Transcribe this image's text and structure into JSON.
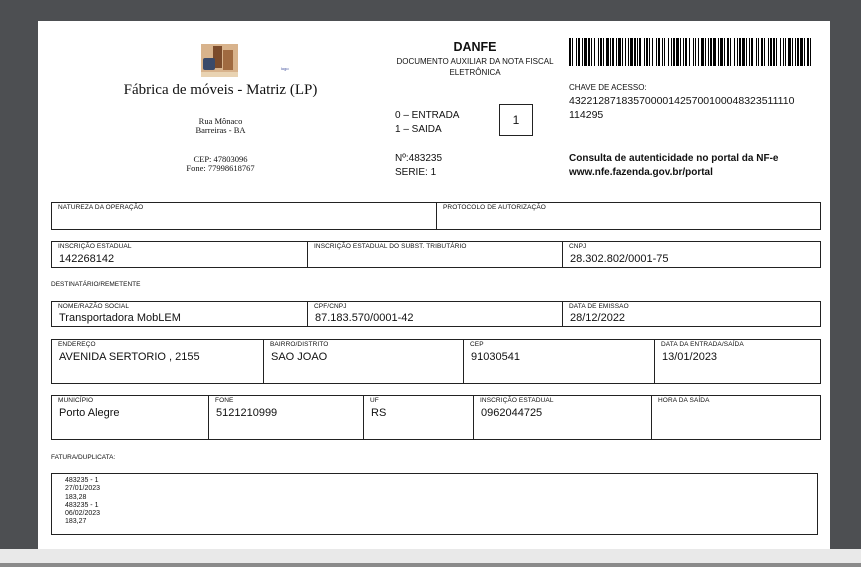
{
  "issuer": {
    "name": "Fábrica de móveis - Matriz (LP)",
    "logo_caption": "logo",
    "street": "Rua Mônaco",
    "city": "Barreiras - BA",
    "cep": "CEP: 47803096",
    "phone": "Fone: 77998618767"
  },
  "danfe": {
    "title": "DANFE",
    "subtitle": "DOCUMENTO AUXILIAR DA NOTA FISCAL ELETRÔNICA",
    "entrada": "0 – ENTRADA",
    "saida": "1 – SAIDA",
    "tipo": "1",
    "numero": "Nº:483235",
    "serie": "SERIE: 1"
  },
  "access": {
    "label": "CHAVE DE ACESSO:",
    "key_line1": "432212871835700001425700100048323511110",
    "key_line2": "114295",
    "consult_line1": "Consulta de autenticidade no portal da NF-e",
    "consult_line2": "www.nfe.fazenda.gov.br/portal"
  },
  "operation": {
    "natureza_label": "NATUREZA DA OPERAÇÃO",
    "natureza_value": "",
    "protocolo_label": "PROTOCOLO DE AUTORIZAÇÃO",
    "protocolo_value": ""
  },
  "issuer_tax": {
    "ie_label": "INSCRIÇÃO ESTADUAL",
    "ie_value": "142268142",
    "ie_st_label": "INSCRIÇÃO ESTADUAL DO SUBST. TRIBUTÁRIO",
    "ie_st_value": "",
    "cnpj_label": "CNPJ",
    "cnpj_value": "28.302.802/0001-75"
  },
  "recipient_section": "DESTINATÁRIO/REMETENTE",
  "recipient": {
    "name_label": "NOME/RAZÃO SOCIAL",
    "name_value": "Transportadora MobLEM",
    "doc_label": "CPF/CNPJ",
    "doc_value": "87.183.570/0001-42",
    "emission_label": "DATA DE EMISSAO",
    "emission_value": "28/12/2022",
    "address_label": "ENDEREÇO",
    "address_value": "AVENIDA SERTORIO , 2155",
    "district_label": "BAIRRO/DISTRITO",
    "district_value": "SAO JOAO",
    "cep_label": "CEP",
    "cep_value": "91030541",
    "entry_label": "DATA DA ENTRADA/SAÍDA",
    "entry_value": "13/01/2023",
    "city_label": "MUNICÍPIO",
    "city_value": "Porto Alegre",
    "phone_label": "FONE",
    "phone_value": "5121210999",
    "uf_label": "UF",
    "uf_value": "RS",
    "ie_label": "INSCRIÇÃO ESTADUAL",
    "ie_value": "0962044725",
    "exit_time_label": "HORA DA SAÍDA",
    "exit_time_value": ""
  },
  "billing": {
    "section": "FATURA/DUPLICATA:",
    "lines": [
      "483235 - 1",
      "27/01/2023",
      "183,28",
      "483235 - 1",
      "06/02/2023",
      "183,27"
    ]
  }
}
